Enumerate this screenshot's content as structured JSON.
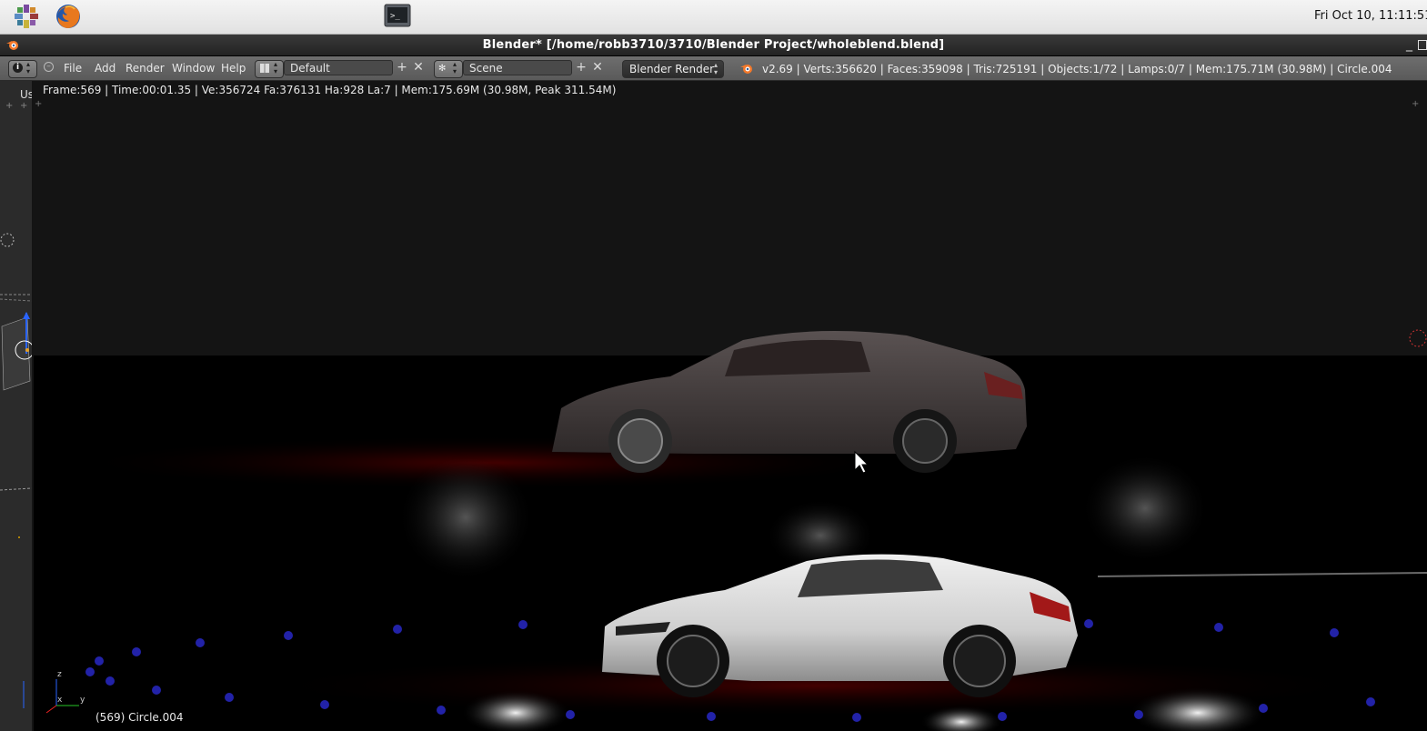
{
  "desktop": {
    "clock": "Fri Oct 10, 11:11:51"
  },
  "window": {
    "title": "Blender* [/home/robb3710/3710/Blender Project/wholeblend.blend]"
  },
  "info_header": {
    "menus": [
      "File",
      "Add",
      "Render",
      "Window",
      "Help"
    ],
    "layout_field": "Default",
    "scene_field": "Scene",
    "render_engine": "Blender Render",
    "stats": "v2.69 | Verts:356620 | Faces:359098 | Tris:725191 | Objects:1/72 | Lamps:0/7 | Mem:175.71M (30.98M) | Circle.004"
  },
  "viewport": {
    "render_info": "Frame:569 | Time:00:01.35 | Ve:356724 Fa:376131 Ha:928 La:7 | Mem:175.69M (30.98M, Peak 311.54M)",
    "object_label": "(569) Circle.004",
    "left_panel_tab": "Us",
    "axis_z": "z",
    "axis_x": "x",
    "axis_y": "y"
  },
  "colors": {
    "ui_header": "#626262",
    "titlebar": "#2e2e2e",
    "render_background": "#000000",
    "floor_glow": "#2a0000",
    "lights_blue": "#2020a0"
  }
}
